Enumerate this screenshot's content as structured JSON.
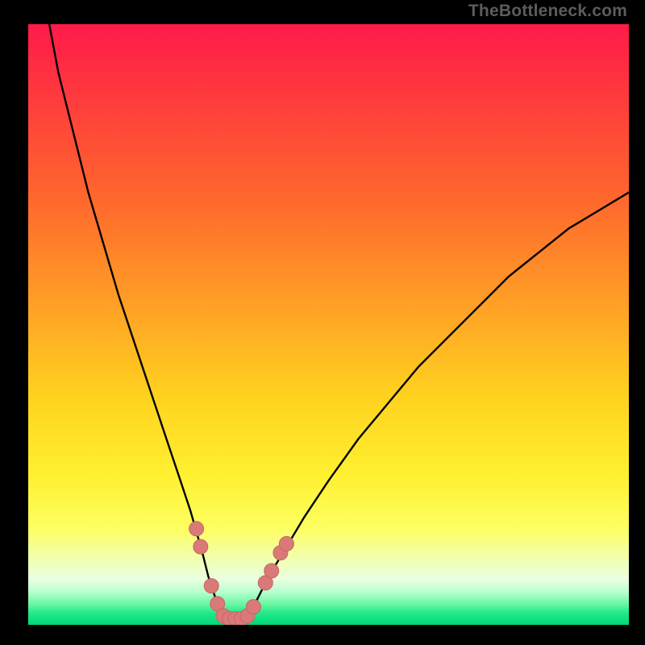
{
  "watermark": "TheBottleneck.com",
  "colors": {
    "curve": "#000000",
    "markers_fill": "#d97a78",
    "markers_stroke": "#c86560",
    "gradient_stops": [
      {
        "offset": 0.0,
        "hex": "#ff1a4a"
      },
      {
        "offset": 0.12,
        "hex": "#ff3a3d"
      },
      {
        "offset": 0.3,
        "hex": "#ff6a2c"
      },
      {
        "offset": 0.48,
        "hex": "#ffa425"
      },
      {
        "offset": 0.62,
        "hex": "#ffd21f"
      },
      {
        "offset": 0.75,
        "hex": "#fff030"
      },
      {
        "offset": 0.84,
        "hex": "#fdff62"
      },
      {
        "offset": 0.89,
        "hex": "#f1ffb0"
      },
      {
        "offset": 0.925,
        "hex": "#e9ffe0"
      },
      {
        "offset": 0.945,
        "hex": "#b8ffcf"
      },
      {
        "offset": 0.965,
        "hex": "#6cf7a3"
      },
      {
        "offset": 0.98,
        "hex": "#23e98a"
      },
      {
        "offset": 1.0,
        "hex": "#00d878"
      }
    ]
  },
  "chart_data": {
    "type": "line",
    "title": "",
    "xlabel": "",
    "ylabel": "",
    "xlim": [
      0,
      100
    ],
    "ylim": [
      0,
      100
    ],
    "x": [
      0,
      2,
      5,
      10,
      15,
      20,
      23,
      25,
      27,
      29,
      30,
      31,
      32,
      33,
      34,
      35,
      36,
      37,
      38,
      40,
      43,
      46,
      50,
      55,
      60,
      65,
      70,
      75,
      80,
      85,
      90,
      95,
      100
    ],
    "y": [
      120,
      108,
      92,
      72,
      55,
      40,
      31,
      25,
      19,
      12,
      8,
      5,
      2,
      1,
      1,
      1,
      1,
      2,
      4,
      8,
      13,
      18,
      24,
      31,
      37,
      43,
      48,
      53,
      58,
      62,
      66,
      69,
      72
    ],
    "markers": [
      {
        "x": 28.0,
        "y": 16.0
      },
      {
        "x": 28.7,
        "y": 13.0
      },
      {
        "x": 30.5,
        "y": 6.5
      },
      {
        "x": 31.5,
        "y": 3.5
      },
      {
        "x": 32.5,
        "y": 1.5
      },
      {
        "x": 33.5,
        "y": 1.0
      },
      {
        "x": 34.5,
        "y": 1.0
      },
      {
        "x": 35.5,
        "y": 1.0
      },
      {
        "x": 36.5,
        "y": 1.5
      },
      {
        "x": 37.5,
        "y": 3.0
      },
      {
        "x": 39.5,
        "y": 7.0
      },
      {
        "x": 40.5,
        "y": 9.0
      },
      {
        "x": 42.0,
        "y": 12.0
      },
      {
        "x": 43.0,
        "y": 13.5
      }
    ],
    "marker_radius_px": 9
  }
}
